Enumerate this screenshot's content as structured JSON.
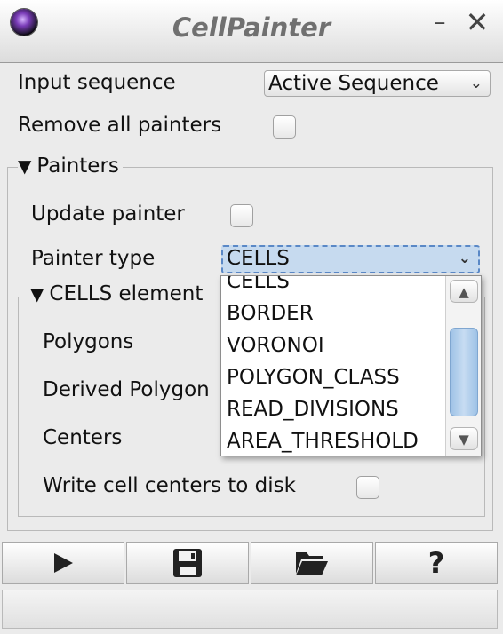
{
  "window": {
    "title": "CellPainter",
    "icon": "app-sphere-icon",
    "minimize_glyph": "–",
    "close_glyph": "✕"
  },
  "input_sequence": {
    "label": "Input sequence",
    "selected": "Active Sequence",
    "chevron": "⌄"
  },
  "remove_all_painters": {
    "label": "Remove all painters",
    "checked": false
  },
  "painters_section": {
    "title": "Painters",
    "expander": "▼",
    "update_painter": {
      "label": "Update painter",
      "checked": false
    },
    "painter_type": {
      "label": "Painter type",
      "selected": "CELLS",
      "chevron": "⌄",
      "dropdown_options": [
        "CELLS",
        "BORDER",
        "VORONOI",
        "POLYGON_CLASS",
        "READ_DIVISIONS",
        "AREA_THRESHOLD"
      ]
    }
  },
  "cells_section": {
    "title": "CELLS element",
    "expander": "▼",
    "polygons_label": "Polygons",
    "derived_polygons_label": "Derived Polygon",
    "centers_label": "Centers",
    "write_centers": {
      "label": "Write cell centers to disk",
      "checked": false
    }
  },
  "toolbar": {
    "buttons": [
      {
        "icon": "play-icon"
      },
      {
        "icon": "save-icon"
      },
      {
        "icon": "folder-open-icon"
      },
      {
        "icon": "help-icon",
        "glyph": "?"
      }
    ]
  },
  "colors": {
    "selection_bg": "#c6daef",
    "selection_border": "#5a88c6",
    "scroll_thumb": "#9ec2e6",
    "title_text": "#707070"
  }
}
